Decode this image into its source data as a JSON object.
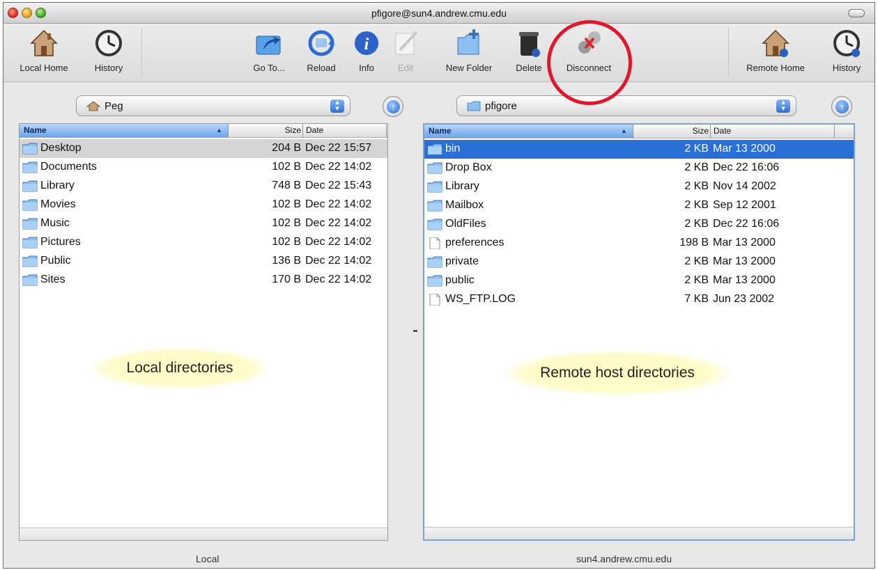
{
  "window": {
    "title": "pfigore@sun4.andrew.cmu.edu"
  },
  "toolbar": {
    "local_home": "Local Home",
    "history_left": "History",
    "goto": "Go To...",
    "reload": "Reload",
    "info": "Info",
    "edit": "Edit",
    "new_folder": "New Folder",
    "delete": "Delete",
    "disconnect": "Disconnect",
    "remote_home": "Remote Home",
    "history_right": "History"
  },
  "local": {
    "path": "Peg",
    "columns": {
      "name": "Name",
      "size": "Size",
      "date": "Date"
    },
    "files": [
      {
        "name": "Desktop",
        "size": "204 B",
        "date": "Dec 22 15:57",
        "type": "folder",
        "selected": true
      },
      {
        "name": "Documents",
        "size": "102 B",
        "date": "Dec 22 14:02",
        "type": "folder"
      },
      {
        "name": "Library",
        "size": "748 B",
        "date": "Dec 22 15:43",
        "type": "folder"
      },
      {
        "name": "Movies",
        "size": "102 B",
        "date": "Dec 22 14:02",
        "type": "folder"
      },
      {
        "name": "Music",
        "size": "102 B",
        "date": "Dec 22 14:02",
        "type": "folder"
      },
      {
        "name": "Pictures",
        "size": "102 B",
        "date": "Dec 22 14:02",
        "type": "folder"
      },
      {
        "name": "Public",
        "size": "136 B",
        "date": "Dec 22 14:02",
        "type": "folder"
      },
      {
        "name": "Sites",
        "size": "170 B",
        "date": "Dec 22 14:02",
        "type": "folder"
      }
    ],
    "annotation": "Local directories",
    "status": "Local"
  },
  "remote": {
    "path": "pfigore",
    "columns": {
      "name": "Name",
      "size": "Size",
      "date": "Date"
    },
    "files": [
      {
        "name": "bin",
        "size": "2 KB",
        "date": "Mar 13 2000",
        "type": "folder",
        "selected": true
      },
      {
        "name": "Drop Box",
        "size": "2 KB",
        "date": "Dec 22 16:06",
        "type": "folder"
      },
      {
        "name": "Library",
        "size": "2 KB",
        "date": "Nov 14 2002",
        "type": "folder"
      },
      {
        "name": "Mailbox",
        "size": "2 KB",
        "date": "Sep 12 2001",
        "type": "folder"
      },
      {
        "name": "OldFiles",
        "size": "2 KB",
        "date": "Dec 22 16:06",
        "type": "folder"
      },
      {
        "name": "preferences",
        "size": "198 B",
        "date": "Mar 13 2000",
        "type": "file"
      },
      {
        "name": "private",
        "size": "2 KB",
        "date": "Mar 13 2000",
        "type": "folder"
      },
      {
        "name": "public",
        "size": "2 KB",
        "date": "Mar 13 2000",
        "type": "folder"
      },
      {
        "name": "WS_FTP.LOG",
        "size": "7 KB",
        "date": "Jun 23 2002",
        "type": "file"
      }
    ],
    "annotation": "Remote host directories",
    "status": "sun4.andrew.cmu.edu"
  },
  "colors": {
    "highlight_ring": "#e3152b",
    "selection_blue": "#2a6fd6",
    "annotation_bg": "#fffbc8"
  }
}
